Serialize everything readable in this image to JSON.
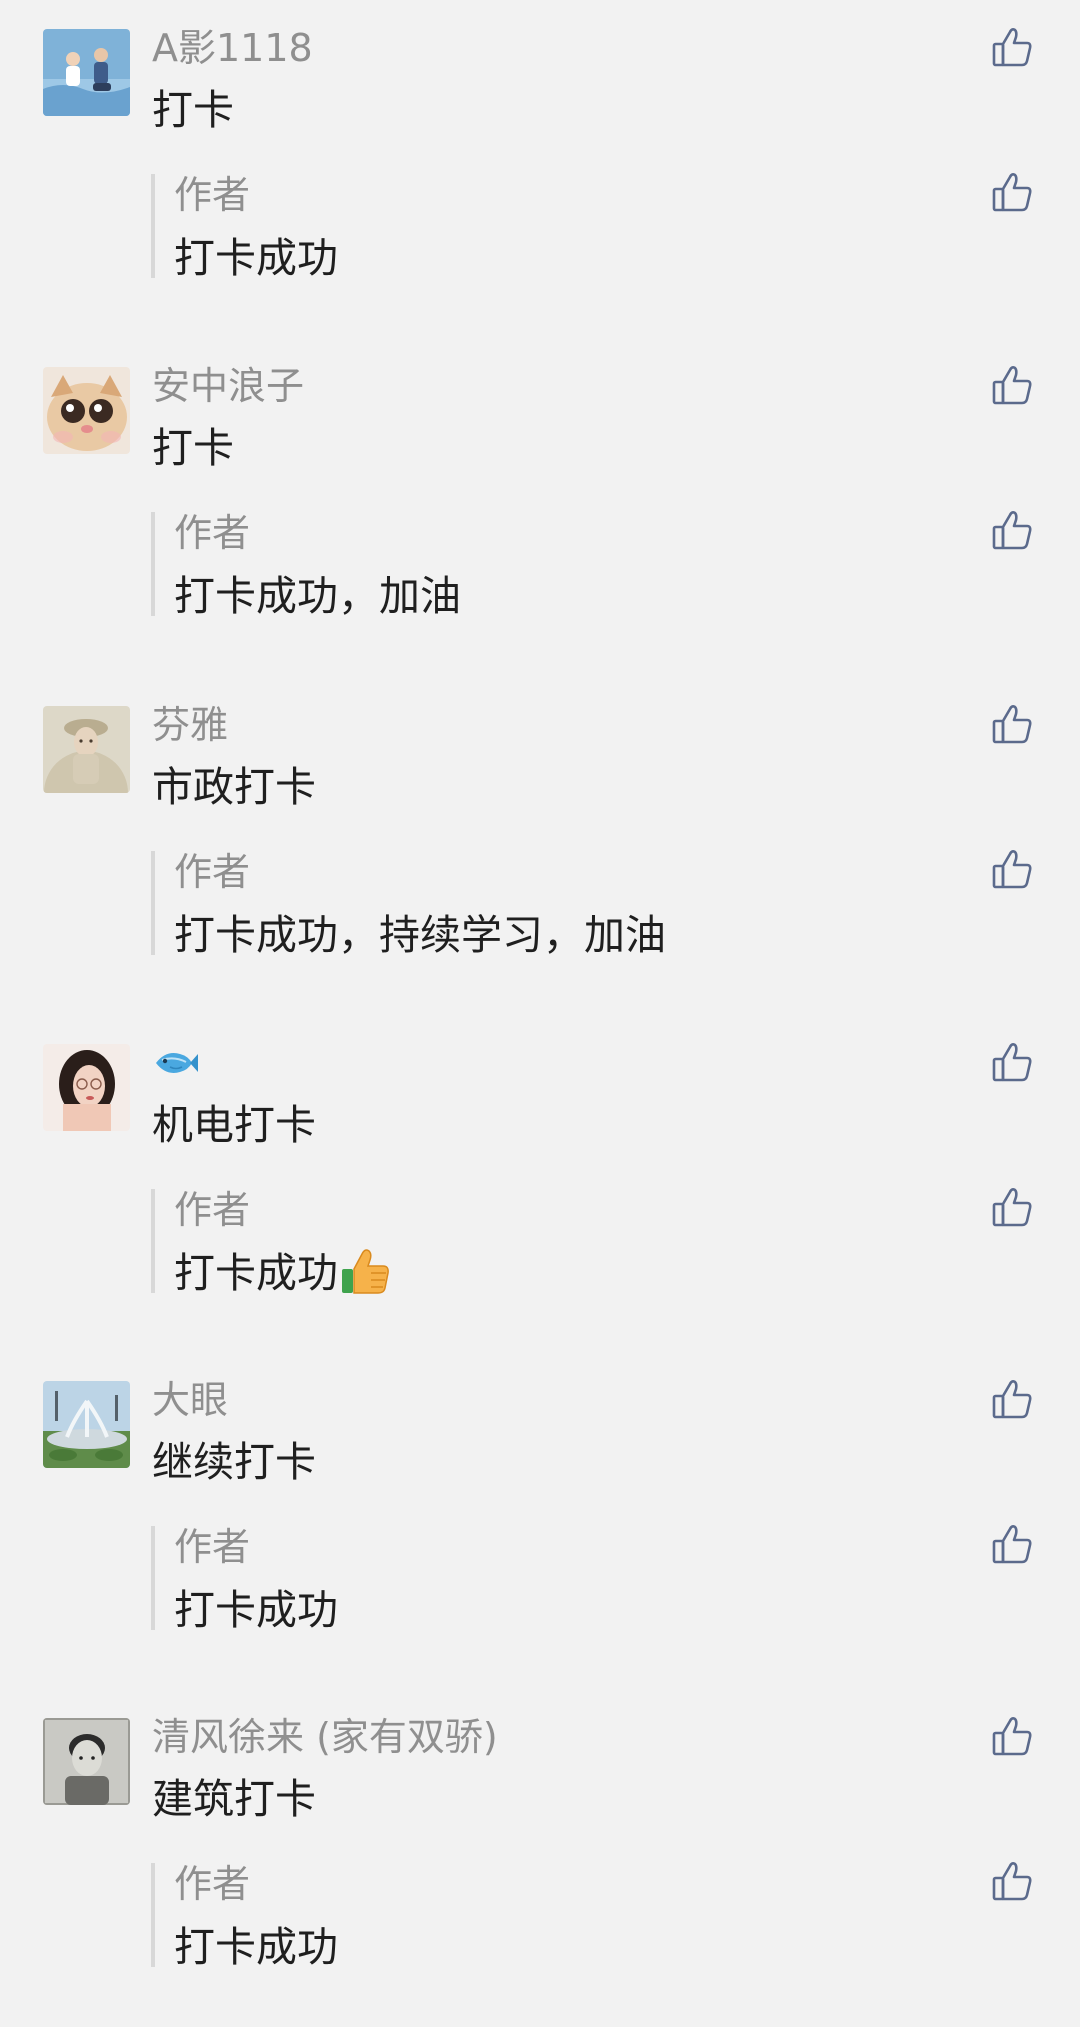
{
  "comments": [
    {
      "nickname": "A影1118",
      "text": "打卡",
      "avatar_icon": "avatar-children-pool",
      "reply": {
        "author": "作者",
        "text": "打卡成功"
      }
    },
    {
      "nickname": "安中浪子",
      "text": "打卡",
      "avatar_icon": "avatar-cat",
      "reply": {
        "author": "作者",
        "text": "打卡成功，加油"
      }
    },
    {
      "nickname": "芬雅",
      "text": "市政打卡",
      "avatar_icon": "avatar-woman-portrait",
      "reply": {
        "author": "作者",
        "text": "打卡成功，持续学习，加油"
      }
    },
    {
      "nickname_icon": "fish-emoji",
      "text": "机电打卡",
      "avatar_icon": "avatar-woman-glasses",
      "reply": {
        "author": "作者",
        "text": "打卡成功",
        "emoji_icon": "thumbs-up-emoji"
      }
    },
    {
      "nickname": "大眼",
      "text": "继续打卡",
      "avatar_icon": "avatar-fountain",
      "reply": {
        "author": "作者",
        "text": "打卡成功"
      }
    },
    {
      "nickname": "清风徐来 (家有双骄)",
      "text": "建筑打卡",
      "avatar_icon": "avatar-boy-portrait",
      "reply": {
        "author": "作者",
        "text": "打卡成功"
      }
    }
  ],
  "like_icon": "thumbs-up-outline-icon",
  "colors": {
    "background": "#f2f2f2",
    "nickname": "#8f8f8f",
    "text": "#1f1f1f",
    "like_icon": "#5b6a8c",
    "reply_bar": "#d8d8d8"
  }
}
